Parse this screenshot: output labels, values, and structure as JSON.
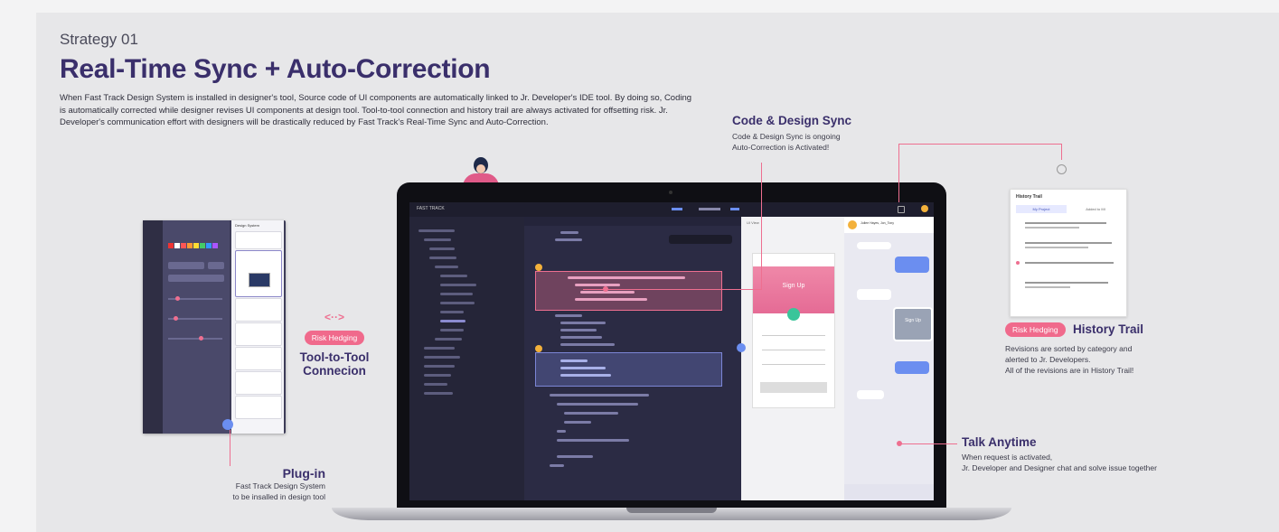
{
  "header": {
    "eyebrow": "Strategy 01",
    "title": "Real-Time Sync + Auto-Correction",
    "intro": "When Fast Track Design System is installed in designer's tool, Source code of UI components are automatically linked to Jr. Developer's IDE tool. By doing so, Coding is automatically corrected while designer revises UI components at design tool. Tool-to-tool connection and history trail are always activated for offsetting risk. Jr. Developer's communication effort with designers will be drastically reduced by Fast Track's Real-Time Sync and Auto-Correction."
  },
  "callouts": {
    "code_sync": {
      "title": "Code & Design Sync",
      "line1": "Code & Design Sync is ongoing",
      "line2": "Auto-Correction is Activated!"
    },
    "tool_to_tool": {
      "icon": "link-arrows-icon",
      "badge": "Risk Hedging",
      "line1": "Tool-to-Tool",
      "line2": "Connecion"
    },
    "history_trail": {
      "badge": "Risk Hedging",
      "title": "History Trail",
      "line1": "Revisions are sorted by category and",
      "line2": "alerted to Jr. Developers.",
      "line3": "All of the revisions are in History Trail!"
    },
    "talk_anytime": {
      "title": "Talk Anytime",
      "line1": "When request is activated,",
      "line2": "Jr. Developer and Designer chat and solve issue together"
    },
    "plugin": {
      "title": "Plug-in",
      "line1": "Fast Track Design System",
      "line2": "to be insalled in design tool"
    }
  },
  "plugin_panel": {
    "header": "Design System"
  },
  "ide": {
    "app_title": "FAST TRACK",
    "preview_tab": "UI View",
    "preview_button": "Sign Up",
    "chat_contact": "Jullee Hayes, Jon_Tony",
    "chat_image_text": "Sign Up"
  },
  "history_card": {
    "title": "History Trail",
    "tab_active": "My Project",
    "tab_other": "Added to MI"
  },
  "colors": {
    "accent": "#ee6f90",
    "brand": "#3a2f6b",
    "ide_bg": "#2a2a3d"
  }
}
